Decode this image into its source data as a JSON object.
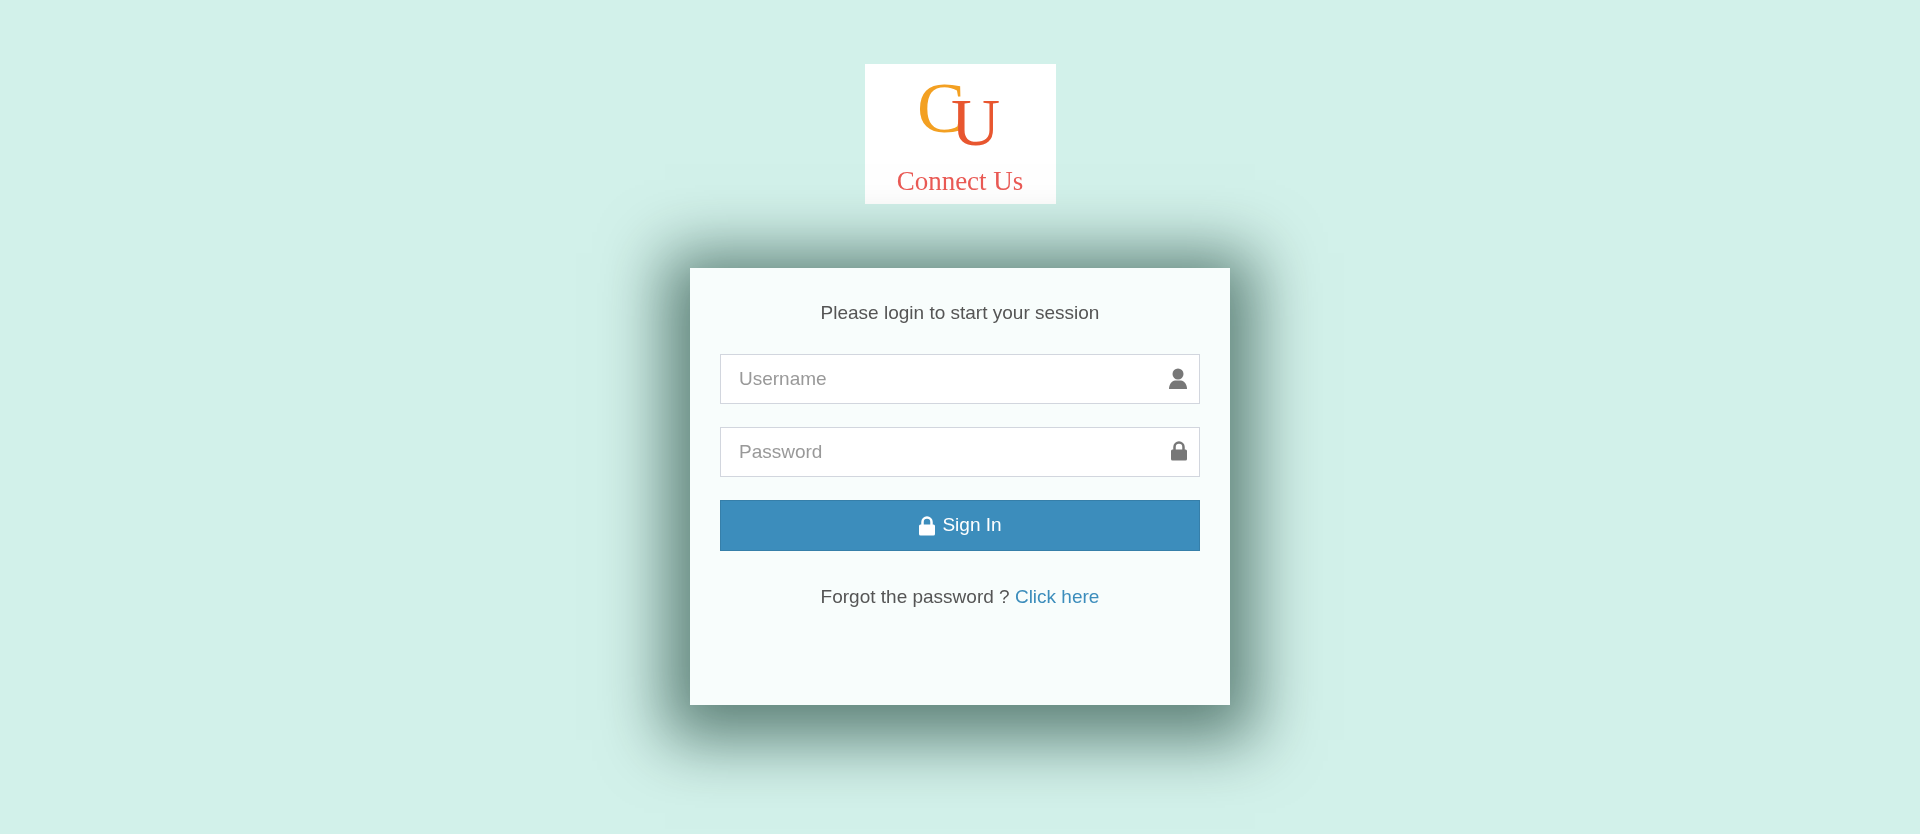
{
  "logo": {
    "mark_first": "C",
    "mark_second": "U",
    "name": "Connect Us"
  },
  "login_box": {
    "message": "Please login to start your session",
    "fields": [
      {
        "placeholder": "Username",
        "kind": "user"
      },
      {
        "placeholder": "Password",
        "kind": "password"
      }
    ],
    "submit": "Sign In",
    "forgot_text": "Forgot the password ?",
    "forgot_link": "Click here"
  }
}
